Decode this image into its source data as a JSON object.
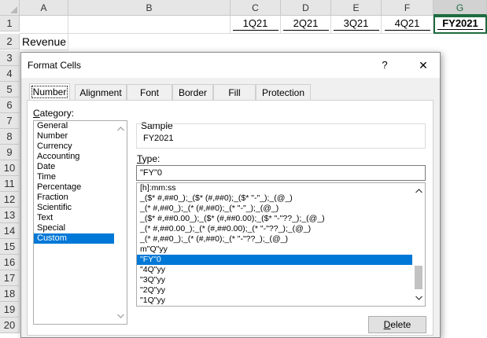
{
  "sheet": {
    "columns": [
      "A",
      "B",
      "C",
      "D",
      "E",
      "F",
      "G"
    ],
    "rows": [
      "1",
      "2",
      "3",
      "4",
      "5",
      "6",
      "7",
      "8",
      "9",
      "10",
      "11",
      "12",
      "13",
      "14",
      "15",
      "16",
      "17",
      "18",
      "19",
      "20"
    ],
    "row1": {
      "c": "1Q21",
      "d": "2Q21",
      "e": "3Q21",
      "f": "4Q21",
      "g": "FY2021"
    },
    "row2": {
      "a": "Revenue"
    }
  },
  "dialog": {
    "title": "Format Cells",
    "help_label": "?",
    "close_label": "✕",
    "tabs": [
      "Number",
      "Alignment",
      "Font",
      "Border",
      "Fill",
      "Protection"
    ],
    "active_tab": "Number",
    "category_label_first": "C",
    "category_label_rest": "ategory:",
    "categories": [
      "General",
      "Number",
      "Currency",
      "Accounting",
      "Date",
      "Time",
      "Percentage",
      "Fraction",
      "Scientific",
      "Text",
      "Special",
      "Custom"
    ],
    "selected_category": "Custom",
    "sample_label": "Sample",
    "sample_value": "FY2021",
    "type_label_first": "T",
    "type_label_rest": "ype:",
    "type_value": "\"FY\"0",
    "formats": [
      "[h]:mm:ss",
      "_($* #,##0_);_($* (#,##0);_($* \"-\"_);_(@_)",
      "_(* #,##0_);_(* (#,##0);_(* \"-\"_);_(@_)",
      "_($* #,##0.00_);_($* (#,##0.00);_($* \"-\"??_);_(@_)",
      "_(* #,##0.00_);_(* (#,##0.00);_(* \"-\"??_);_(@_)",
      "_(* #,##0_);_(* (#,##0);_(* \"-\"??_);_(@_)",
      "m\"Q\"yy",
      "\"FY\"0",
      "\"4Q\"yy",
      "\"3Q\"yy",
      "\"2Q\"yy",
      "\"1Q\"yy"
    ],
    "selected_format": "\"FY\"0",
    "delete_label_first": "D",
    "delete_label_rest": "elete"
  },
  "icons": {
    "scroll_up": "chevron-up-icon",
    "scroll_down": "chevron-down-icon"
  },
  "colors": {
    "selection": "#0078d7",
    "excel_green": "#1e6b3f"
  }
}
